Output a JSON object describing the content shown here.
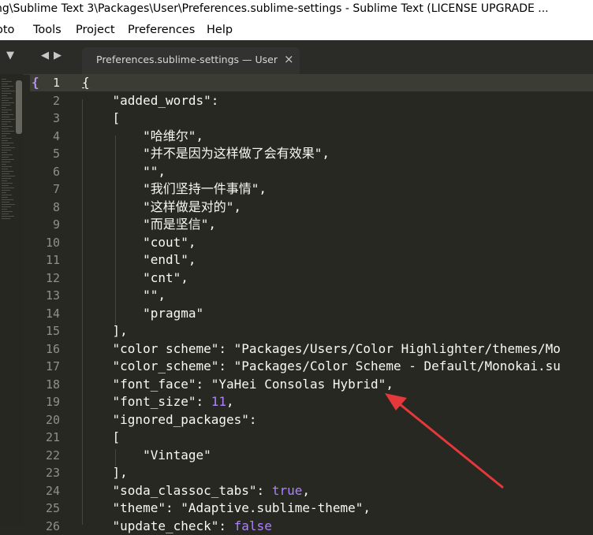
{
  "window": {
    "title": "ng\\Sublime Text 3\\Packages\\User\\Preferences.sublime-settings - Sublime Text (LICENSE UPGRADE ..."
  },
  "menu": [
    "oto",
    "Tools",
    "Project",
    "Preferences",
    "Help"
  ],
  "tab": {
    "label": "Preferences.sublime-settings — User",
    "close": "×"
  },
  "controls": {
    "dropdown": "▼",
    "prev": "◀",
    "next": "▶"
  },
  "editor": {
    "active_line": 1,
    "lines": [
      {
        "n": "1",
        "t": "{"
      },
      {
        "n": "2",
        "t": "    \"added_words\":"
      },
      {
        "n": "3",
        "t": "    ["
      },
      {
        "n": "4",
        "t": "        \"哈维尔\","
      },
      {
        "n": "5",
        "t": "        \"并不是因为这样做了会有效果\","
      },
      {
        "n": "6",
        "t": "        \"\","
      },
      {
        "n": "7",
        "t": "        \"我们坚持一件事情\","
      },
      {
        "n": "8",
        "t": "        \"这样做是对的\","
      },
      {
        "n": "9",
        "t": "        \"而是坚信\","
      },
      {
        "n": "10",
        "t": "        \"cout\","
      },
      {
        "n": "11",
        "t": "        \"endl\","
      },
      {
        "n": "12",
        "t": "        \"cnt\","
      },
      {
        "n": "13",
        "t": "        \"\","
      },
      {
        "n": "14",
        "t": "        \"pragma\""
      },
      {
        "n": "15",
        "t": "    ],"
      },
      {
        "n": "16",
        "t": "    \"color scheme\": \"Packages/Users/Color Highlighter/themes/Mo"
      },
      {
        "n": "17",
        "t": "    \"color_scheme\": \"Packages/Color Scheme - Default/Monokai.su"
      },
      {
        "n": "18",
        "t": "    \"font_face\": \"YaHei Consolas Hybrid\","
      },
      {
        "n": "19",
        "t": "    \"font_size\": 11,"
      },
      {
        "n": "20",
        "t": "    \"ignored_packages\":"
      },
      {
        "n": "21",
        "t": "    ["
      },
      {
        "n": "22",
        "t": "        \"Vintage\""
      },
      {
        "n": "23",
        "t": "    ],"
      },
      {
        "n": "24",
        "t": "    \"soda_classoc_tabs\": true,"
      },
      {
        "n": "25",
        "t": "    \"theme\": \"Adaptive.sublime-theme\","
      },
      {
        "n": "26",
        "t": "    \"update_check\": false"
      }
    ]
  },
  "annotation": {
    "color": "#e5383b"
  }
}
